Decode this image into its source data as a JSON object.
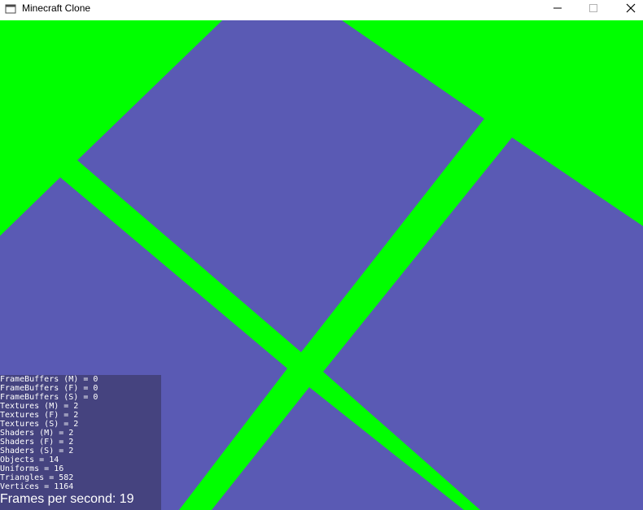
{
  "window": {
    "title": "Minecraft Clone",
    "controls": {
      "minimize": "minimize-icon",
      "maximize": "maximize-icon",
      "close": "close-icon"
    }
  },
  "colors": {
    "sky": "#00ff00",
    "block": "#5a5ab4",
    "panel": "#45437f",
    "text": "#ffffff"
  },
  "stats": {
    "lines": [
      "FrameBuffers (M) = 0",
      "FrameBuffers (F) = 0",
      "FrameBuffers (S) = 0",
      "Textures (M) = 2",
      "Textures (F) = 2",
      "Textures (S) = 2",
      "Shaders (M) = 2",
      "Shaders (F) = 2",
      "Shaders (S) = 2",
      "Objects = 14",
      "Uniforms = 16",
      "Triangles = 582",
      "Vertices = 1164"
    ],
    "fps": "Frames per second: 19"
  }
}
